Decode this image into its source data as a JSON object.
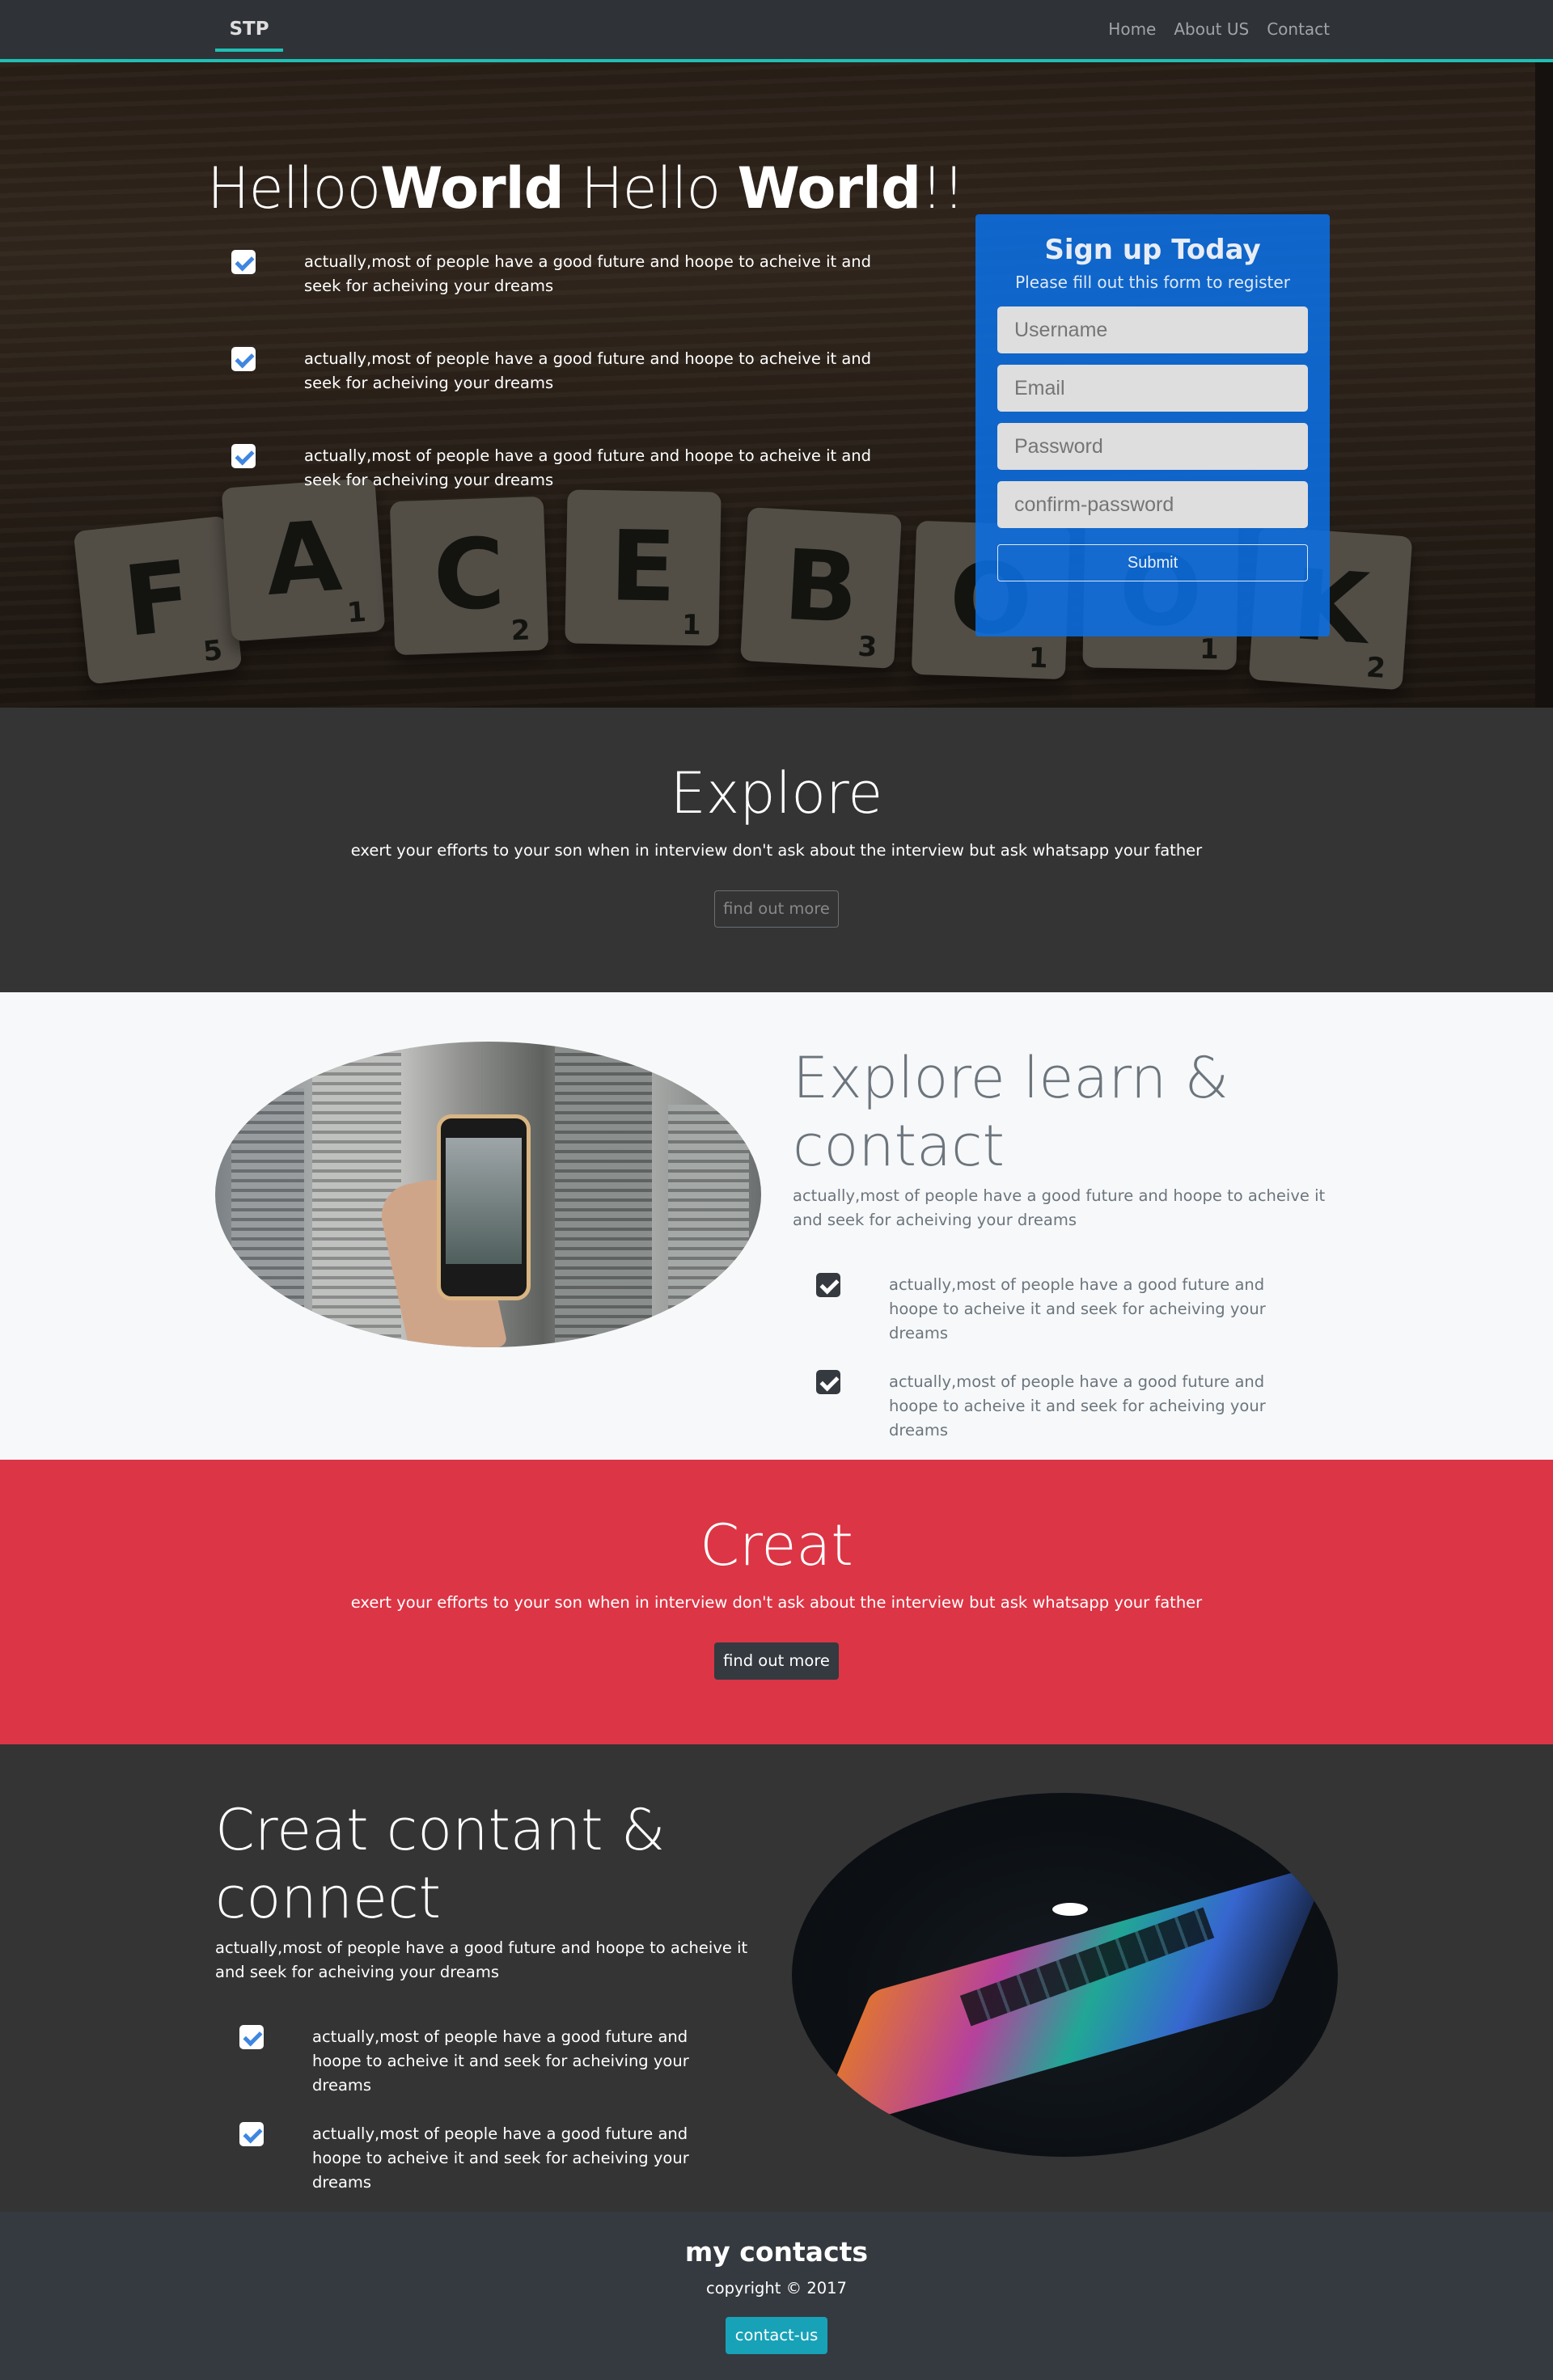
{
  "nav": {
    "brand": "STP",
    "links": [
      "Home",
      "About US",
      "Contact"
    ]
  },
  "hero": {
    "title_part1": "Helloo",
    "title_part2": "World",
    "title_part3": " Hello ",
    "title_part4": "World",
    "title_part5": "!!",
    "bg_tiles": [
      {
        "letter": "F",
        "num": "5"
      },
      {
        "letter": "A",
        "num": "1"
      },
      {
        "letter": "C",
        "num": "2"
      },
      {
        "letter": "E",
        "num": "1"
      },
      {
        "letter": "B",
        "num": "3"
      },
      {
        "letter": "O",
        "num": "1"
      },
      {
        "letter": "O",
        "num": "1"
      },
      {
        "letter": "K",
        "num": "2"
      }
    ],
    "checks": [
      "actually,most of people have a good future and hoope to acheive it and seek for acheiving your dreams",
      "actually,most of people have a good future and hoope to acheive it and seek for acheiving your dreams",
      "actually,most of people have a good future and hoope to acheive it and seek for acheiving your dreams"
    ]
  },
  "signup": {
    "title": "Sign up Today",
    "subtitle": "Please fill out this form to register",
    "username_placeholder": "Username",
    "email_placeholder": "Email",
    "password_placeholder": "Password",
    "confirm_placeholder": "confirm-password",
    "submit_label": "Submit"
  },
  "explore": {
    "title": "Explore",
    "text": "exert your efforts to your son when in interview don't ask about the interview but ask whatsapp your father",
    "button": "find out more"
  },
  "learn": {
    "title": "Explore learn & contact",
    "desc": "actually,most of people have a good future and hoope to acheive it and seek for acheiving your dreams",
    "checks": [
      "actually,most of people have a good future and hoope to acheive it and seek for acheiving your dreams",
      "actually,most of people have a good future and hoope to acheive it and seek for acheiving your dreams"
    ]
  },
  "creat": {
    "title": "Creat",
    "text": "exert your efforts to your son when in interview don't ask about the interview but ask whatsapp your father",
    "button": "find out more"
  },
  "content": {
    "title": "Creat contant & connect",
    "desc": "actually,most of people have a good future and hoope to acheive it and seek for acheiving your dreams",
    "checks": [
      "actually,most of people have a good future and hoope to acheive it and seek for acheiving your dreams",
      "actually,most of people have a good future and hoope to acheive it and seek for acheiving your dreams"
    ]
  },
  "footer": {
    "title": "my contacts",
    "copyright": "copyright © 2017",
    "button": "contact-us"
  },
  "colors": {
    "accent": "#20c0b4",
    "signup_bg": "#0b6ee1",
    "creat_bg": "#dc3545",
    "info": "#17a2b8",
    "dark": "#343a40"
  }
}
